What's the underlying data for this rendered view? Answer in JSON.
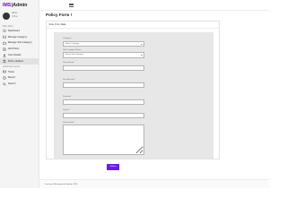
{
  "brand": {
    "accent": "IMS",
    "separator": "|",
    "name": "Admin",
    "accent_color": "#6a0dad"
  },
  "user": {
    "name": "admin",
    "status": "Online"
  },
  "sidebar": {
    "section_main": "Main Menu",
    "items": [
      {
        "label": "Dashboard",
        "icon": "home-icon"
      },
      {
        "label": "Manage Category",
        "icon": "folder-icon"
      },
      {
        "label": "Manage Sub-Category",
        "icon": "folder-icon"
      },
      {
        "label": "Add Policy",
        "icon": "file-icon"
      },
      {
        "label": "User Details",
        "icon": "user-icon"
      },
      {
        "label": "Policy Holders",
        "icon": "users-icon"
      }
    ],
    "section_secondary": "Ask/Answer query",
    "items2": [
      {
        "label": "Ticket",
        "icon": "ticket-icon"
      },
      {
        "label": "Report",
        "icon": "report-icon"
      },
      {
        "label": "Search",
        "icon": "search-icon"
      }
    ]
  },
  "page": {
    "title": "Policy Form !"
  },
  "card": {
    "header_prefix": "Make Policy",
    "header_bold": "here"
  },
  "form": {
    "category_label": "Category *",
    "category_value": "Select Category",
    "subcategory_label": "Sub Category Name *",
    "subcategory_value": "Select Sub Category",
    "policy_name_label": "Policy Name *",
    "sum_assured_label": "Sum Assured *",
    "premium_label": "Premium *",
    "tenure_label": "Tenure *",
    "description_label": "Policy Detail *",
    "submit_label": "Submit"
  },
  "footer": {
    "text": "Insurance Management System 2020"
  },
  "colors": {
    "primary": "#6a1ee0"
  }
}
